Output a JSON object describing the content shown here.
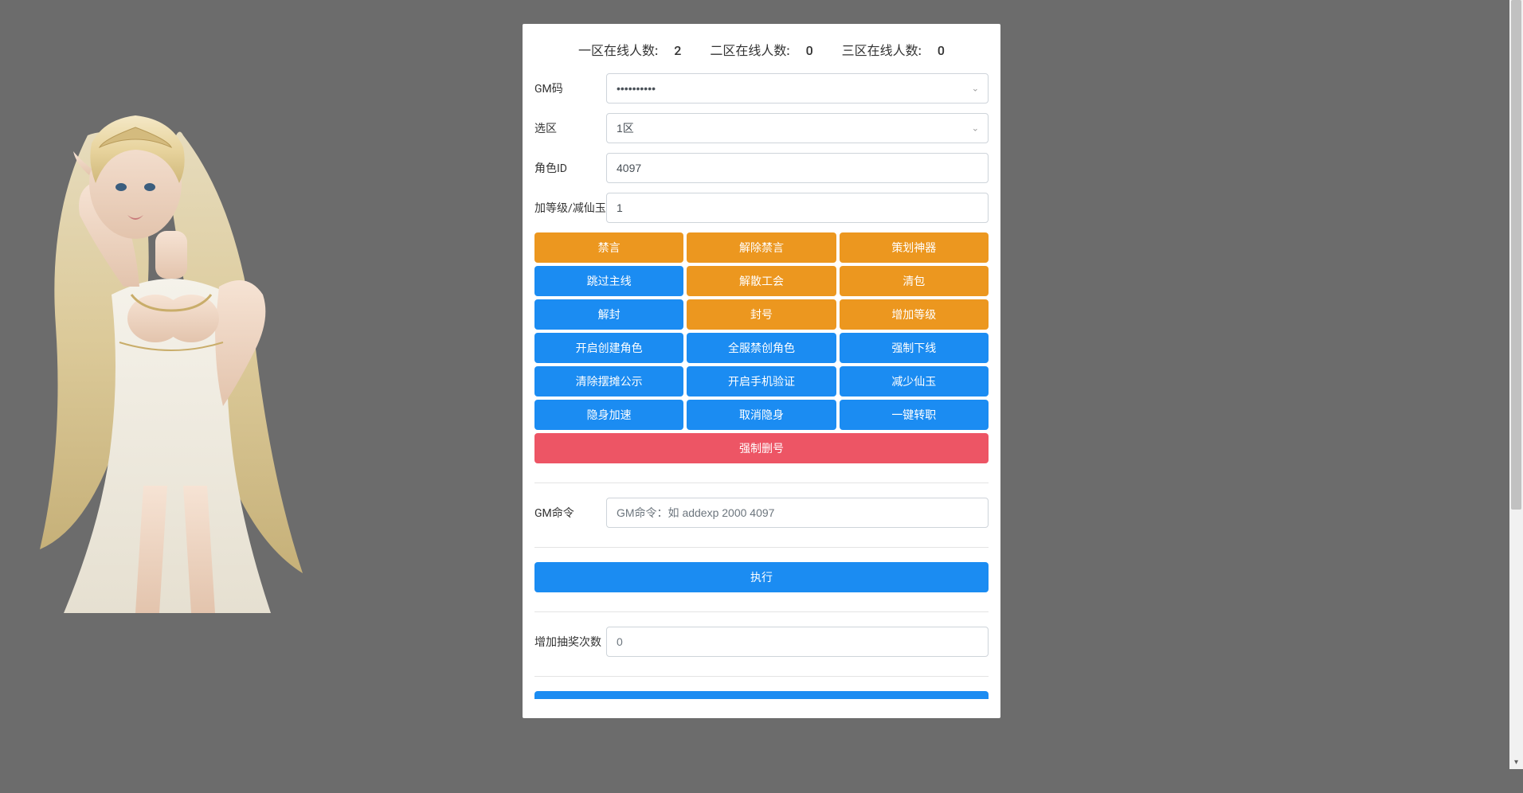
{
  "header": {
    "zone1_label": "一区在线人数:",
    "zone1_count": "2",
    "zone2_label": "二区在线人数:",
    "zone2_count": "0",
    "zone3_label": "三区在线人数:",
    "zone3_count": "0"
  },
  "fields": {
    "gm_code_label": "GM码",
    "gm_code_value": "••••••••••",
    "zone_label": "选区",
    "zone_value": "1区",
    "role_id_label": "角色ID",
    "role_id_value": "4097",
    "level_label": "加等级/减仙玉",
    "level_value": "1",
    "gm_cmd_label": "GM命令",
    "gm_cmd_placeholder": "GM命令：如 addexp 2000 4097",
    "draw_count_label": "增加抽奖次数",
    "draw_count_placeholder": "0"
  },
  "buttons": {
    "row1": [
      "禁言",
      "解除禁言",
      "策划神器"
    ],
    "row2": [
      "跳过主线",
      "解散工会",
      "清包"
    ],
    "row3": [
      "解封",
      "封号",
      "增加等级"
    ],
    "row4": [
      "开启创建角色",
      "全服禁创角色",
      "强制下线"
    ],
    "row5": [
      "清除摆摊公示",
      "开启手机验证",
      "减少仙玉"
    ],
    "row6": [
      "隐身加速",
      "取消隐身",
      "一键转职"
    ],
    "force_delete": "强制删号",
    "execute": "执行"
  },
  "colors": {
    "warning": "#ec971f",
    "primary": "#1b8cf2",
    "danger": "#ed5565"
  }
}
